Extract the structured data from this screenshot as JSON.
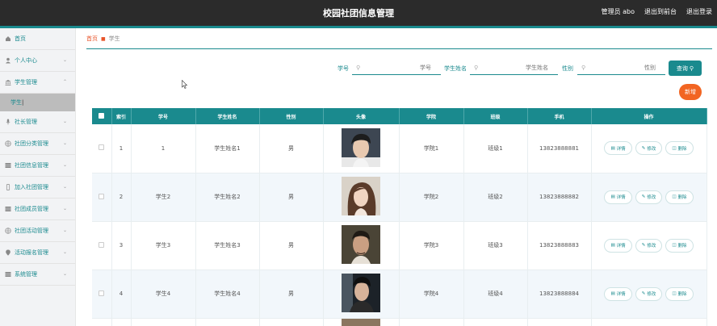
{
  "header": {
    "title": "校园社团信息管理",
    "admin_label": "管理员 abo",
    "exit_backend": "退出到前台",
    "logout": "退出登录"
  },
  "sidebar": {
    "items": [
      {
        "label": "首页",
        "icon": "home-icon",
        "expandable": false
      },
      {
        "label": "个人中心",
        "icon": "user-icon",
        "expandable": true
      },
      {
        "label": "学生管理",
        "icon": "bank-icon",
        "expandable": true,
        "expanded": true
      },
      {
        "label": "社长管理",
        "icon": "mic-icon",
        "expandable": true
      },
      {
        "label": "社团分类管理",
        "icon": "globe-icon",
        "expandable": true
      },
      {
        "label": "社团信息管理",
        "icon": "grid-icon",
        "expandable": true
      },
      {
        "label": "加入社团管理",
        "icon": "phone-icon",
        "expandable": true
      },
      {
        "label": "社团成员管理",
        "icon": "grid-icon",
        "expandable": true
      },
      {
        "label": "社团活动管理",
        "icon": "globe-icon",
        "expandable": true
      },
      {
        "label": "活动报名管理",
        "icon": "pin-icon",
        "expandable": true
      },
      {
        "label": "系统管理",
        "icon": "grid-icon",
        "expandable": true
      }
    ],
    "sub_item": "学生"
  },
  "breadcrumb": {
    "home": "首页",
    "current": "学生"
  },
  "search": {
    "fields": [
      {
        "label": "学号",
        "placeholder": "学号"
      },
      {
        "label": "学生姓名",
        "placeholder": "学生姓名"
      },
      {
        "label": "性别",
        "placeholder": "性别"
      }
    ],
    "button": "查询"
  },
  "add_button": "新增",
  "table": {
    "columns": [
      "",
      "索引",
      "学号",
      "学生姓名",
      "性别",
      "头像",
      "学院",
      "班级",
      "手机",
      "操作"
    ],
    "rows": [
      {
        "index": "1",
        "id": "1",
        "name": "学生姓名1",
        "gender": "男",
        "college": "学院1",
        "class": "班级1",
        "phone": "13823888881"
      },
      {
        "index": "2",
        "id": "学生2",
        "name": "学生姓名2",
        "gender": "男",
        "college": "学院2",
        "class": "班级2",
        "phone": "13823888882"
      },
      {
        "index": "3",
        "id": "学生3",
        "name": "学生姓名3",
        "gender": "男",
        "college": "学院3",
        "class": "班级3",
        "phone": "13823888883"
      },
      {
        "index": "4",
        "id": "学生4",
        "name": "学生姓名4",
        "gender": "男",
        "college": "学院4",
        "class": "班级4",
        "phone": "13823888884"
      }
    ],
    "actions": {
      "detail": "详情",
      "edit": "修改",
      "delete": "删除"
    }
  },
  "colors": {
    "accent": "#1a8a8e",
    "orange": "#f26522",
    "header_bg": "#2b2b2b"
  }
}
